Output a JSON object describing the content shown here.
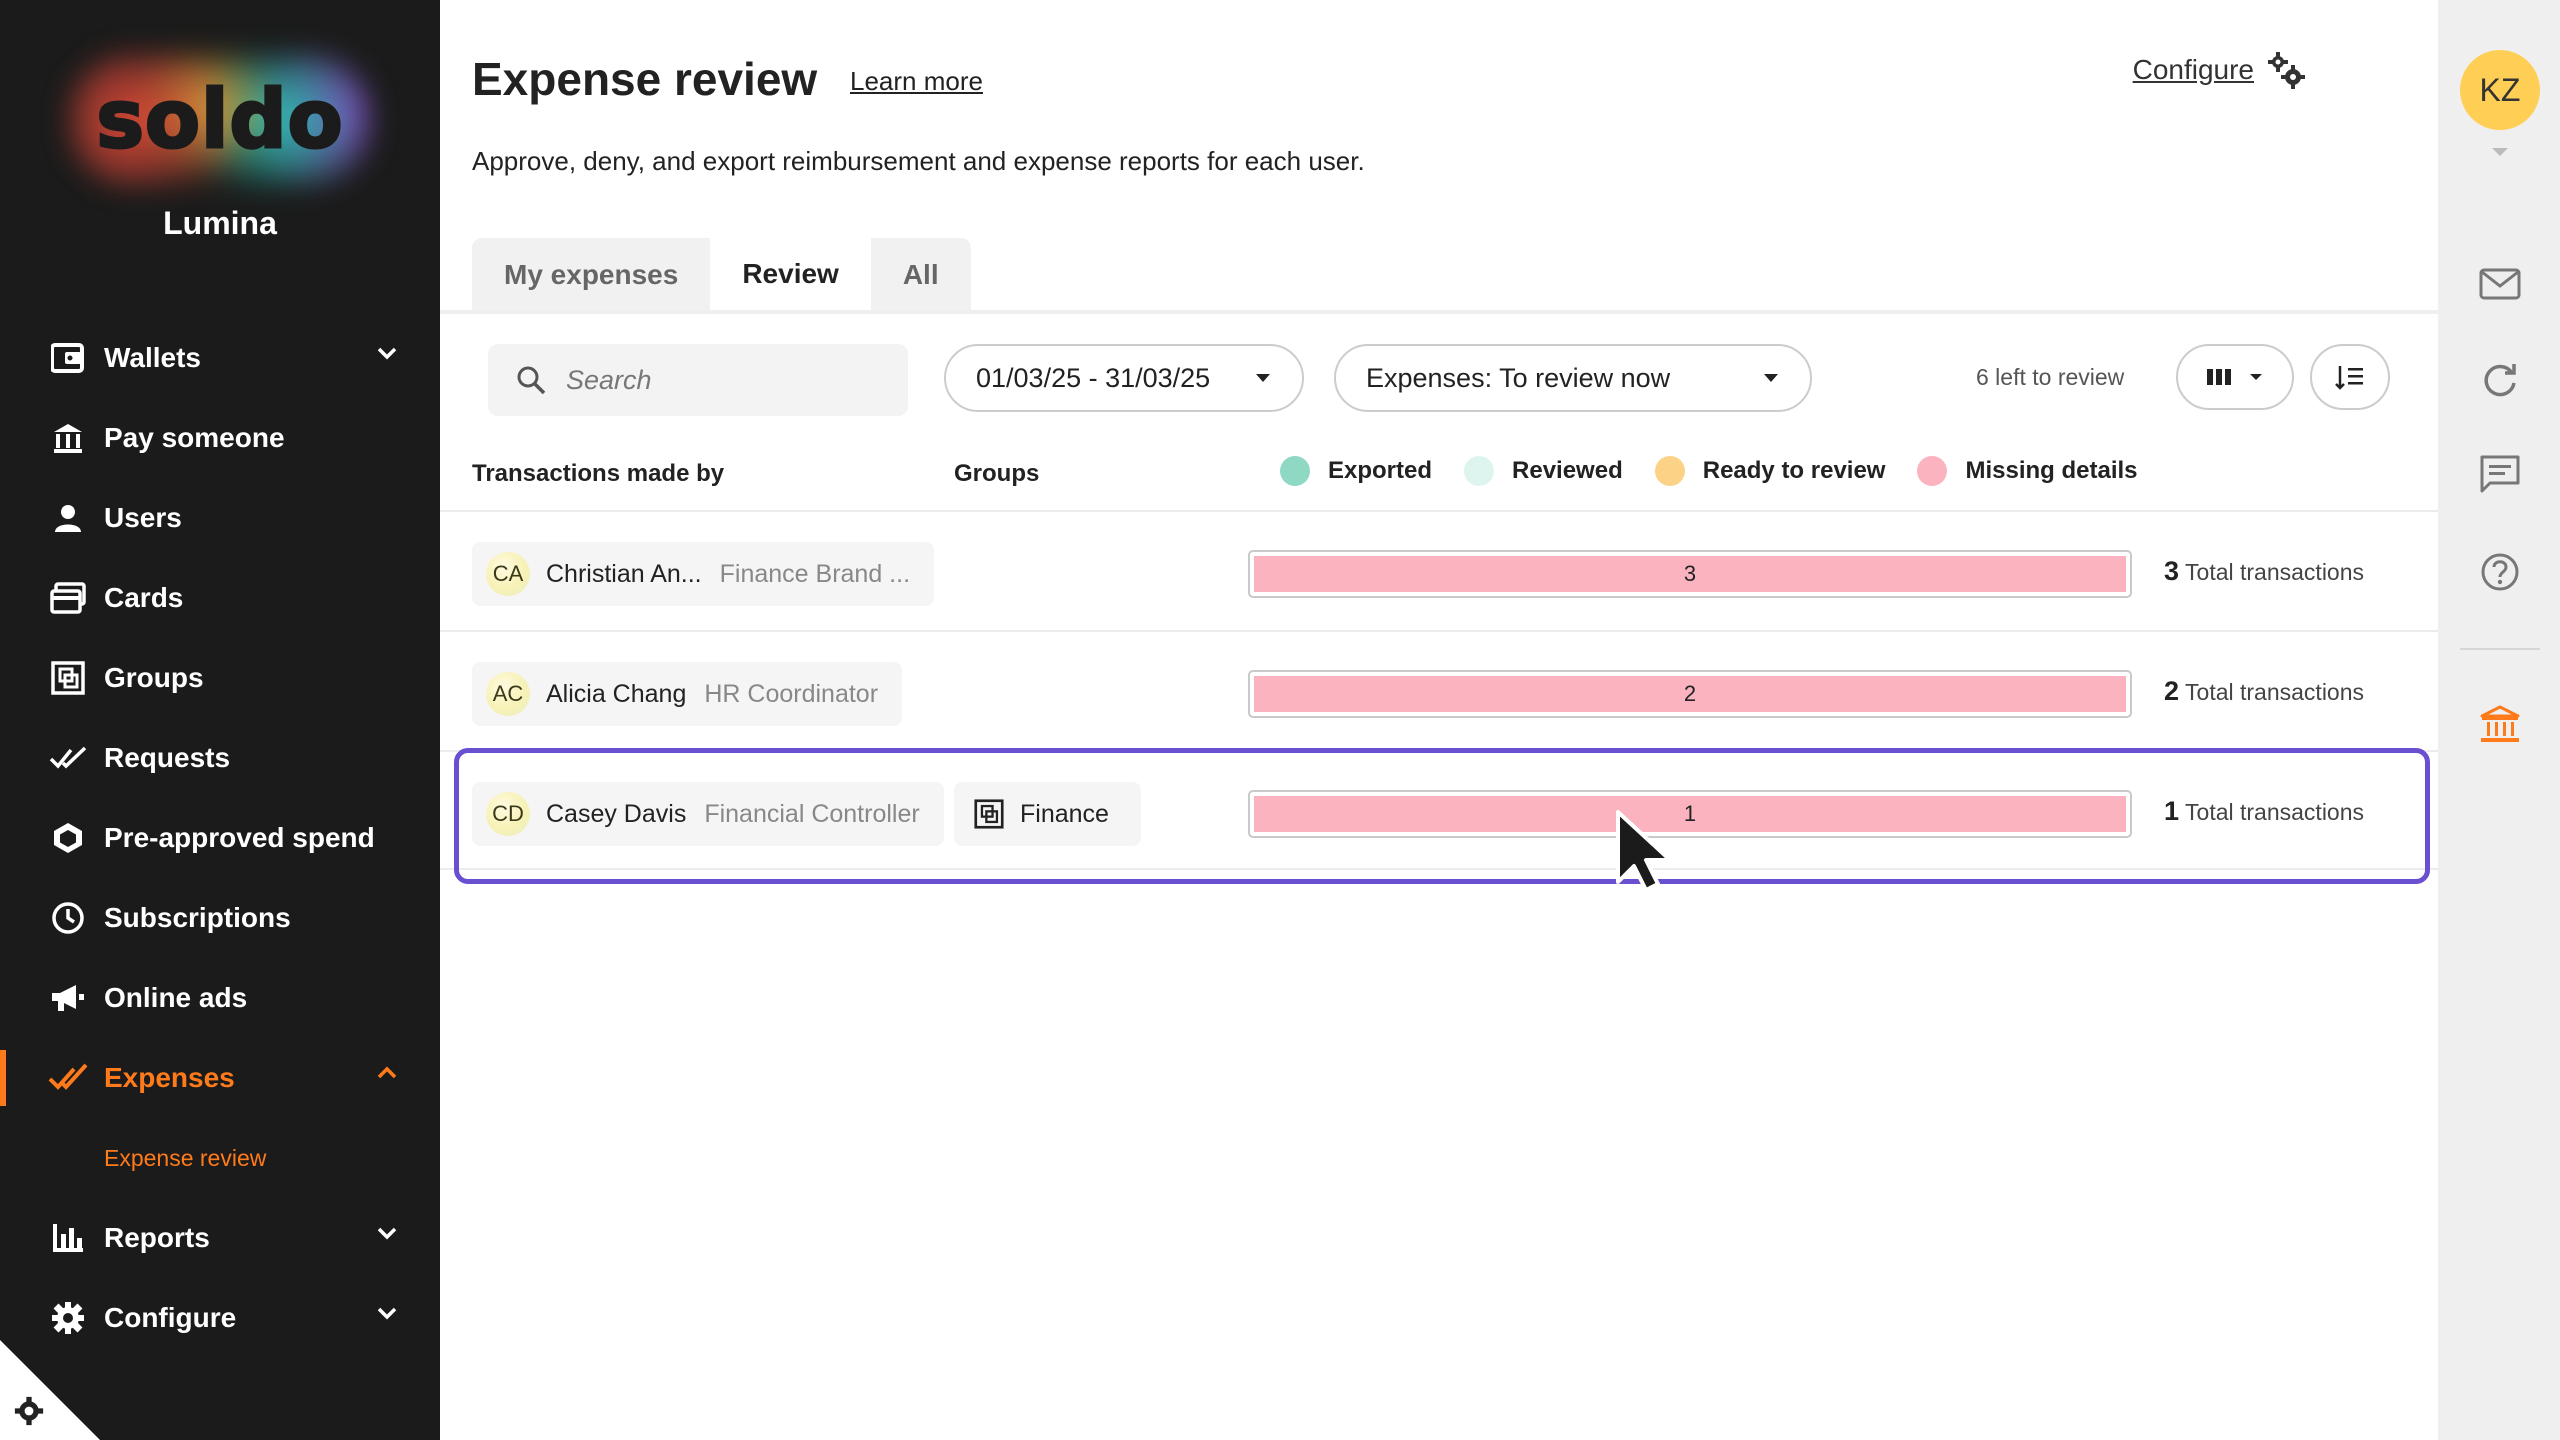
{
  "brand": {
    "logo_text": "soldo",
    "org_name": "Lumina"
  },
  "nav": {
    "items": [
      {
        "label": "Wallets",
        "icon": "wallet-icon",
        "chevron": "down"
      },
      {
        "label": "Pay someone",
        "icon": "bank-transfer-icon"
      },
      {
        "label": "Users",
        "icon": "user-icon"
      },
      {
        "label": "Cards",
        "icon": "cards-icon"
      },
      {
        "label": "Groups",
        "icon": "groups-icon"
      },
      {
        "label": "Requests",
        "icon": "requests-check-icon"
      },
      {
        "label": "Pre-approved spend",
        "icon": "hexagon-icon"
      },
      {
        "label": "Subscriptions",
        "icon": "clock-icon"
      },
      {
        "label": "Online ads",
        "icon": "megaphone-icon"
      },
      {
        "label": "Expenses",
        "icon": "expenses-check-icon",
        "chevron": "up",
        "active": true
      },
      {
        "label": "Reports",
        "icon": "bar-chart-icon",
        "chevron": "down"
      },
      {
        "label": "Configure",
        "icon": "gear-icon",
        "chevron": "down"
      }
    ],
    "expenses_sub": "Expense review"
  },
  "header": {
    "title": "Expense review",
    "learn_more": "Learn more",
    "configure": "Configure",
    "description": "Approve, deny, and export reimbursement and expense reports for each user."
  },
  "tabs": [
    {
      "label": "My expenses"
    },
    {
      "label": "Review",
      "active": true
    },
    {
      "label": "All"
    }
  ],
  "toolbar": {
    "search_placeholder": "Search",
    "date_range": "01/03/25 - 31/03/25",
    "filter": "Expenses: To review now",
    "left_to_review": "6 left to review"
  },
  "table": {
    "col_transactions_by": "Transactions made by",
    "col_groups": "Groups",
    "legend": [
      {
        "label": "Exported",
        "color": "#8fd9c4"
      },
      {
        "label": "Reviewed",
        "color": "#ddf5ee"
      },
      {
        "label": "Ready to review",
        "color": "#fcd386"
      },
      {
        "label": "Missing details",
        "color": "#fbb3c0"
      }
    ],
    "rows": [
      {
        "initials": "CA",
        "name": "Christian An...",
        "role": "Finance Brand ...",
        "group": "",
        "count": "3",
        "total": "3",
        "total_label": "Total transactions"
      },
      {
        "initials": "AC",
        "name": "Alicia Chang",
        "role": "HR Coordinator",
        "group": "",
        "count": "2",
        "total": "2",
        "total_label": "Total transactions"
      },
      {
        "initials": "CD",
        "name": "Casey Davis",
        "role": "Financial Controller",
        "group": "Finance",
        "count": "1",
        "total": "1",
        "total_label": "Total transactions"
      }
    ]
  },
  "rail": {
    "user_initials": "KZ"
  },
  "colors": {
    "accent": "#ff7a1a",
    "highlight": "#6a4fd0",
    "missing": "#fbb3c0"
  }
}
